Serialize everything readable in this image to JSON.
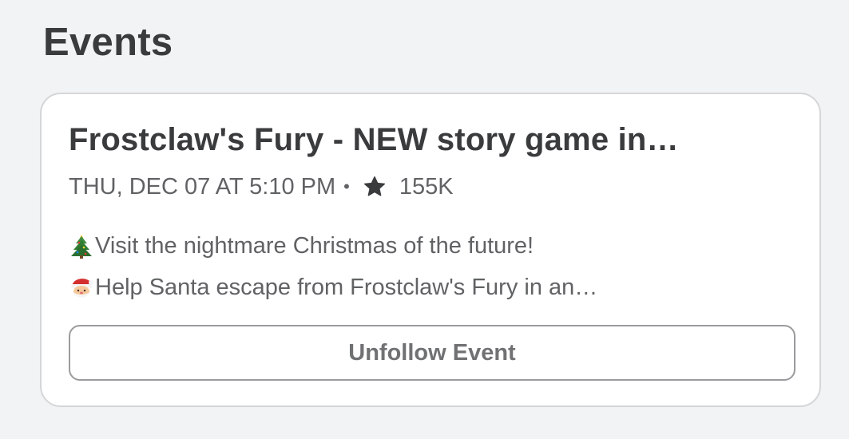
{
  "section": {
    "title": "Events"
  },
  "event": {
    "title": "Frostclaw's Fury - NEW story game in…",
    "date": "THU, DEC 07 AT 5:10 PM",
    "separator": "•",
    "interested_count": "155K",
    "description_lines": [
      {
        "icon": "christmas-tree-icon",
        "text": "Visit the nightmare Christmas of the future!"
      },
      {
        "icon": "santa-face-icon",
        "text": "Help Santa escape from Frostclaw's Fury in an…"
      }
    ],
    "button_label": "Unfollow Event"
  },
  "colors": {
    "background": "#f2f3f4",
    "card": "#ffffff",
    "title_text": "#393b3d",
    "secondary_text": "#606264",
    "button_border": "#9a9b9d"
  }
}
